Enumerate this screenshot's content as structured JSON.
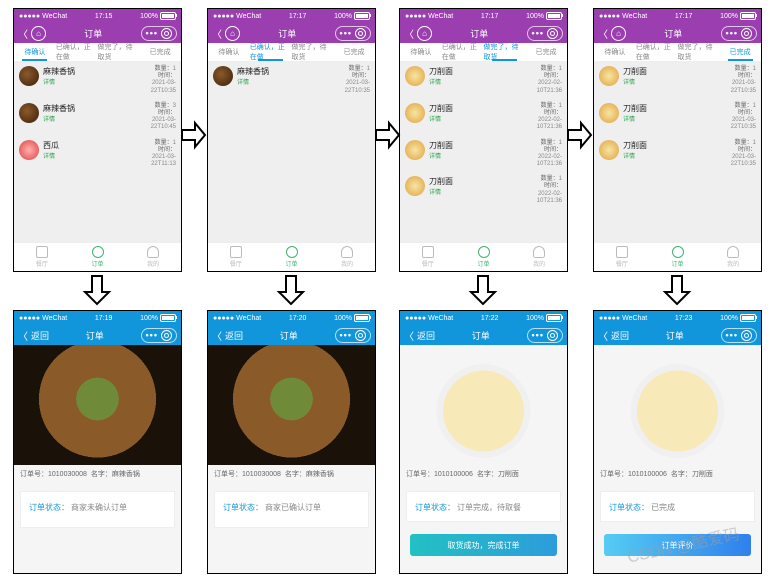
{
  "statusbar": {
    "carrier": "●●●●● WeChat",
    "battery": "100%"
  },
  "top_times": [
    "17:15",
    "17:17",
    "17:17",
    "17:17"
  ],
  "bottom_times": [
    "17:19",
    "17:20",
    "17:22",
    "17:23"
  ],
  "nav": {
    "orders_title": "订单",
    "back_label": "返回",
    "detail_title": "订单",
    "more": "•••"
  },
  "tabs": {
    "pending": "待确认",
    "confirmed": "已确认，正在做",
    "pickup": "做完了，待取货",
    "done": "已完成"
  },
  "tabbar": {
    "hall": "餐厅",
    "orders": "订单",
    "me": "我的"
  },
  "row_meta": {
    "count_label": "数量：",
    "time_label": "时间：",
    "count1": "1",
    "count3": "3",
    "date1": "2021-03-22T10:35",
    "date2": "2021-03-22T10:45",
    "date3": "2022-02-10T21:36",
    "date4": "2021-03-22T11:13"
  },
  "items": {
    "pot_name": "麻辣香锅",
    "pot_sub": "详情",
    "noodle_name": "刀削面",
    "noodle_sub": "详情",
    "dish3_name": "西瓜",
    "dish3_sub": "详情"
  },
  "detail": {
    "id_label": "订单号：",
    "name_label": "名字：",
    "status_label": "订单状态：",
    "pot_id": "1010030008",
    "pot_name": "麻辣香锅",
    "noodle_id": "1010100006",
    "noodle_name": "刀削面",
    "status_pending": "商家未确认订单",
    "status_confirmed": "商家已确认订单",
    "status_pickup": "订单完成，待取餐",
    "status_done": "已完成",
    "btn_pickup_done": "取货成功，完成订单",
    "btn_review": "订单评价"
  },
  "watermark": "CSDN @酷爱码"
}
